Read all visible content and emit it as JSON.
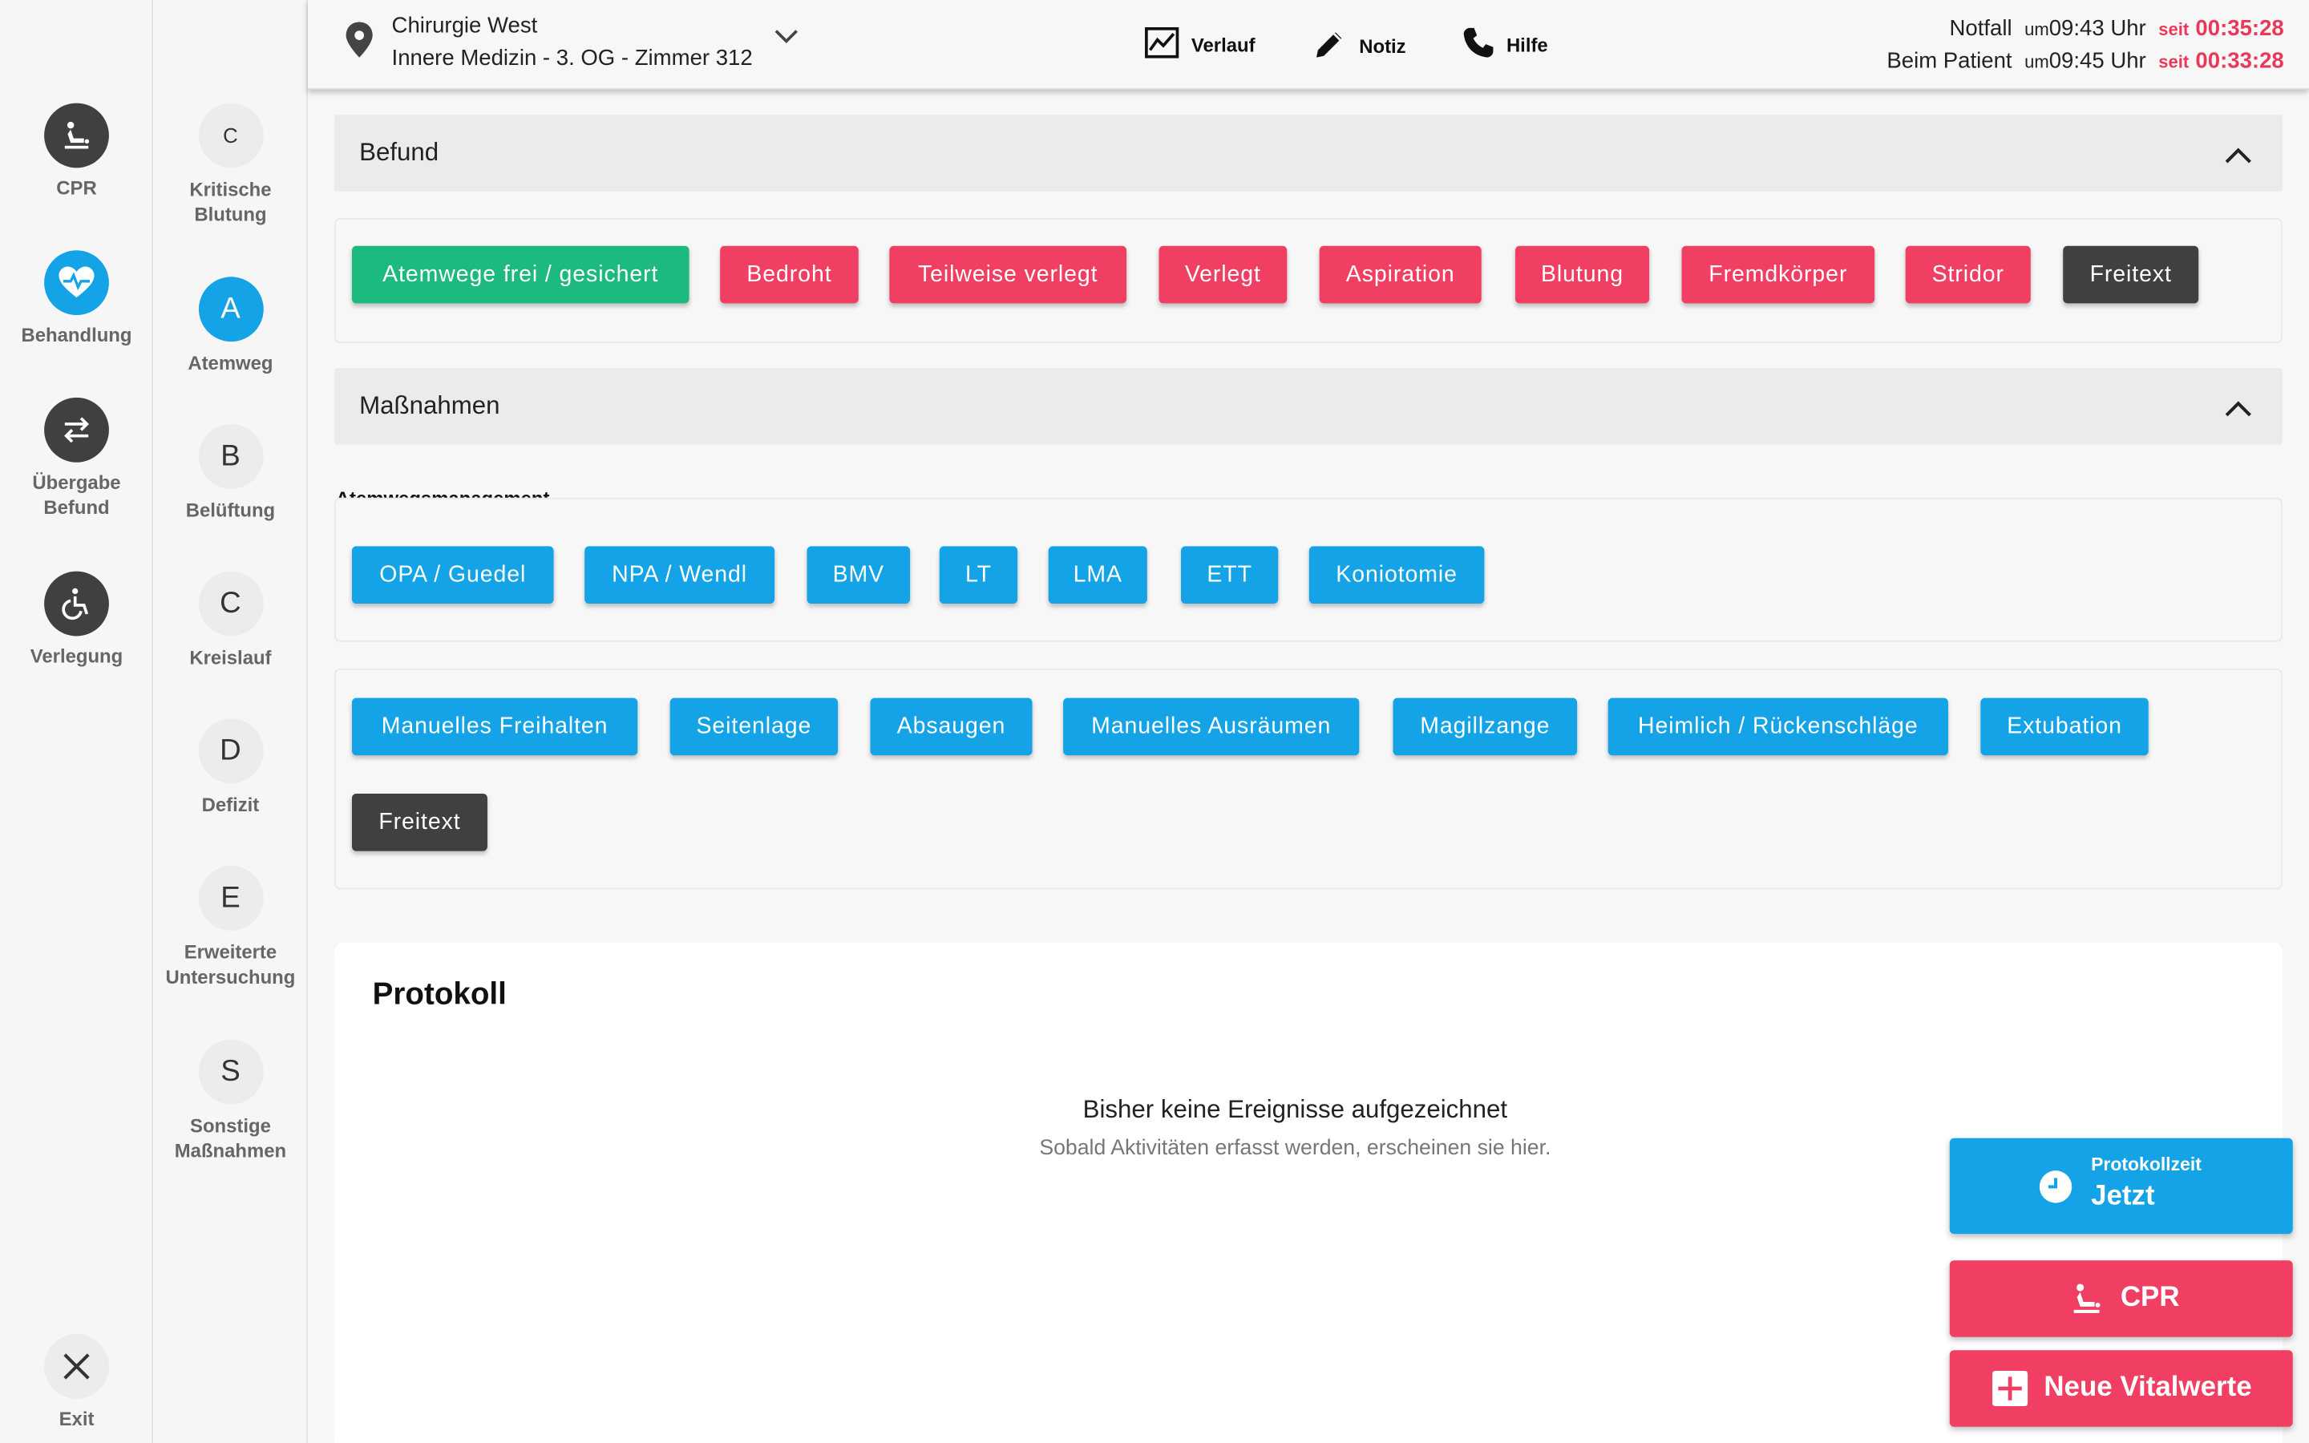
{
  "nav": {
    "items": [
      {
        "label": "CPR"
      },
      {
        "label": "Behandlung"
      },
      {
        "label": "Übergabe\nBefund"
      },
      {
        "label": "Verlegung"
      }
    ],
    "exit": "Exit"
  },
  "abcde": [
    {
      "letter": "C",
      "label": "Kritische\nBlutung"
    },
    {
      "letter": "A",
      "label": "Atemweg"
    },
    {
      "letter": "B",
      "label": "Belüftung"
    },
    {
      "letter": "C",
      "label": "Kreislauf"
    },
    {
      "letter": "D",
      "label": "Defizit"
    },
    {
      "letter": "E",
      "label": "Erweiterte\nUntersuchung"
    },
    {
      "letter": "S",
      "label": "Sonstige\nMaßnahmen"
    }
  ],
  "header": {
    "location_line1": "Chirurgie West",
    "location_line2": "Innere Medizin - 3. OG - Zimmer 312",
    "actions": {
      "verlauf": "Verlauf",
      "notiz": "Notiz",
      "hilfe": "Hilfe"
    },
    "times": [
      {
        "label": "Notfall",
        "um": "um",
        "time": "09:43 Uhr",
        "seit": "seit",
        "elapsed": "00:35:28"
      },
      {
        "label": "Beim Patient",
        "um": "um",
        "time": "09:45 Uhr",
        "seit": "seit",
        "elapsed": "00:33:28"
      }
    ]
  },
  "befund": {
    "title": "Befund",
    "buttons": [
      "Atemwege frei / gesichert",
      "Bedroht",
      "Teilweise verlegt",
      "Verlegt",
      "Aspiration",
      "Blutung",
      "Fremdkörper",
      "Stridor",
      "Freitext"
    ]
  },
  "massnahmen": {
    "title": "Maßnahmen",
    "subtitle": "Atemwegsmanagement",
    "group1": [
      "OPA / Guedel",
      "NPA / Wendl",
      "BMV",
      "LT",
      "LMA",
      "ETT",
      "Koniotomie"
    ],
    "group2": [
      "Manuelles Freihalten",
      "Seitenlage",
      "Absaugen",
      "Manuelles Ausräumen",
      "Magillzange",
      "Heimlich / Rückenschläge",
      "Extubation",
      "Freitext"
    ]
  },
  "protokoll": {
    "title": "Protokoll",
    "empty_title": "Bisher keine Ereignisse aufgezeichnet",
    "empty_sub": "Sobald Aktivitäten erfasst werden, erscheinen sie hier."
  },
  "fab": {
    "protokollzeit_label": "Protokollzeit",
    "protokollzeit_value": "Jetzt",
    "cpr": "CPR",
    "vitals": "Neue Vitalwerte"
  },
  "colors": {
    "green": "#1dba80",
    "red": "#f03f62",
    "dark": "#404040",
    "blue": "#13a3e6",
    "timer_red": "#e8395a"
  }
}
